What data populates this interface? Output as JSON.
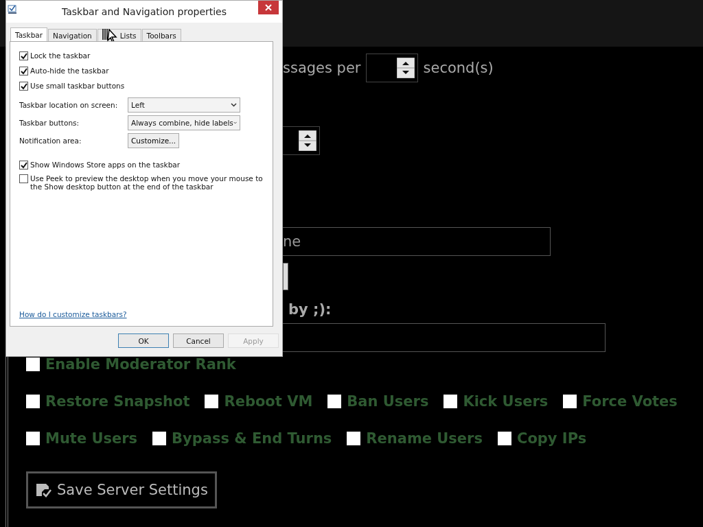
{
  "dialog": {
    "title": "Taskbar and Navigation properties",
    "tabs": [
      {
        "label": "Taskbar",
        "selected": true
      },
      {
        "label": "Navigation",
        "selected": false
      },
      {
        "label": "Lists",
        "selected": false
      },
      {
        "label": "Toolbars",
        "selected": false
      }
    ],
    "options_top": [
      {
        "label": "Lock the taskbar",
        "checked": true
      },
      {
        "label": "Auto-hide the taskbar",
        "checked": true
      },
      {
        "label": "Use small taskbar buttons",
        "checked": true
      }
    ],
    "dropdowns": [
      {
        "label": "Taskbar location on screen:",
        "value": "Left"
      },
      {
        "label": "Taskbar buttons:",
        "value": "Always combine, hide labels"
      }
    ],
    "notification": {
      "label": "Notification area:",
      "button": "Customize..."
    },
    "options_bottom": [
      {
        "label": "Show Windows Store apps on the taskbar",
        "checked": true
      },
      {
        "label": "Use Peek to preview the desktop when you move your mouse to the Show desktop button at the end of the taskbar",
        "checked": false
      }
    ],
    "help_link": "How do I customize taskbars?",
    "buttons": [
      {
        "label": "OK",
        "default": true,
        "disabled": false
      },
      {
        "label": "Cancel",
        "default": false,
        "disabled": false
      },
      {
        "label": "Apply",
        "default": false,
        "disabled": true
      }
    ]
  },
  "page": {
    "rate_label": "ssages per",
    "rate_unit": "second(s)",
    "name_value": "ne",
    "list_label": "by ;):",
    "moderator": {
      "label": "Enable Moderator Rank",
      "checked": false
    },
    "permissions": [
      [
        {
          "label": "Restore Snapshot",
          "checked": false
        },
        {
          "label": "Reboot VM",
          "checked": false
        },
        {
          "label": "Ban Users",
          "checked": false
        },
        {
          "label": "Kick Users",
          "checked": false
        },
        {
          "label": "Force Votes",
          "checked": false
        }
      ],
      [
        {
          "label": "Mute Users",
          "checked": false
        },
        {
          "label": "Bypass & End Turns",
          "checked": false
        },
        {
          "label": "Rename Users",
          "checked": false
        },
        {
          "label": "Copy IPs",
          "checked": false
        }
      ]
    ],
    "save_button": "Save Server Settings"
  }
}
